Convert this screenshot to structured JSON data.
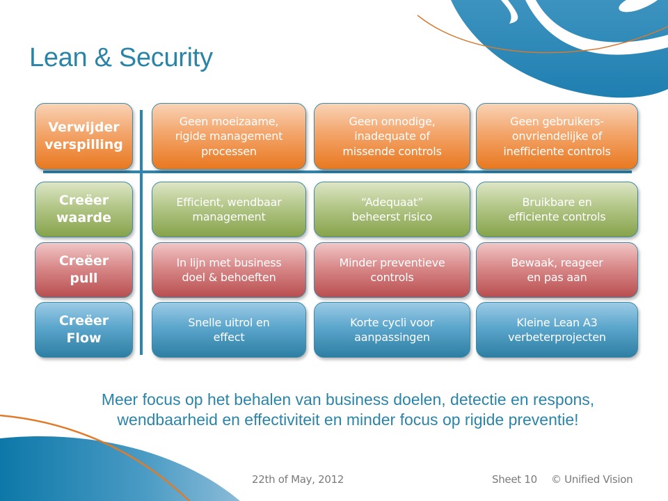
{
  "slide": {
    "title": "Lean & Security",
    "colors": {
      "title": "#2a84a8",
      "orange": "#e8781f",
      "green": "#86a34b",
      "red": "#b84e4f",
      "blue": "#2e7ea3",
      "grid_line": "#2b85b0",
      "accent_curve": "#e07b2a"
    },
    "rows": [
      {
        "theme": "orange",
        "header": "Verwijder\nverspilling",
        "cells": [
          "Geen moeizaame,\nrigide management\nprocessen",
          "Geen onnodige,\ninadequate of\nmissende controls",
          "Geen gebruikers-\nonvriendelijke of\ninefficiente controls"
        ]
      },
      {
        "theme": "green",
        "header": "Creëer\nwaarde",
        "cells": [
          "Efficient, wendbaar\nmanagement",
          "“Adequaat”\nbeheerst risico",
          "Bruikbare en\nefficiente controls"
        ]
      },
      {
        "theme": "red",
        "header": "Creëer\npull",
        "cells": [
          "In lijn met business\ndoel & behoeften",
          "Minder preventieve\ncontrols",
          "Bewaak, reageer\nen pas aan"
        ]
      },
      {
        "theme": "blue",
        "header": "Creëer\nFlow",
        "cells": [
          "Snelle uitrol en\neffect",
          "Korte cycli voor\naanpassingen",
          "Kleine Lean A3\nverbeterprojecten"
        ]
      }
    ],
    "conclusion": "Meer focus op het behalen van business doelen, detectie en respons,\nwendbaarheid en effectiviteit en minder focus op rigide preventie!",
    "footer": {
      "date": "22th of May, 2012",
      "sheet": "Sheet 10",
      "copyright": "© Unified Vision"
    },
    "decorations": {
      "top_right": "logo-swirl-icon",
      "bottom_left": "blue-swoosh-icon"
    }
  }
}
